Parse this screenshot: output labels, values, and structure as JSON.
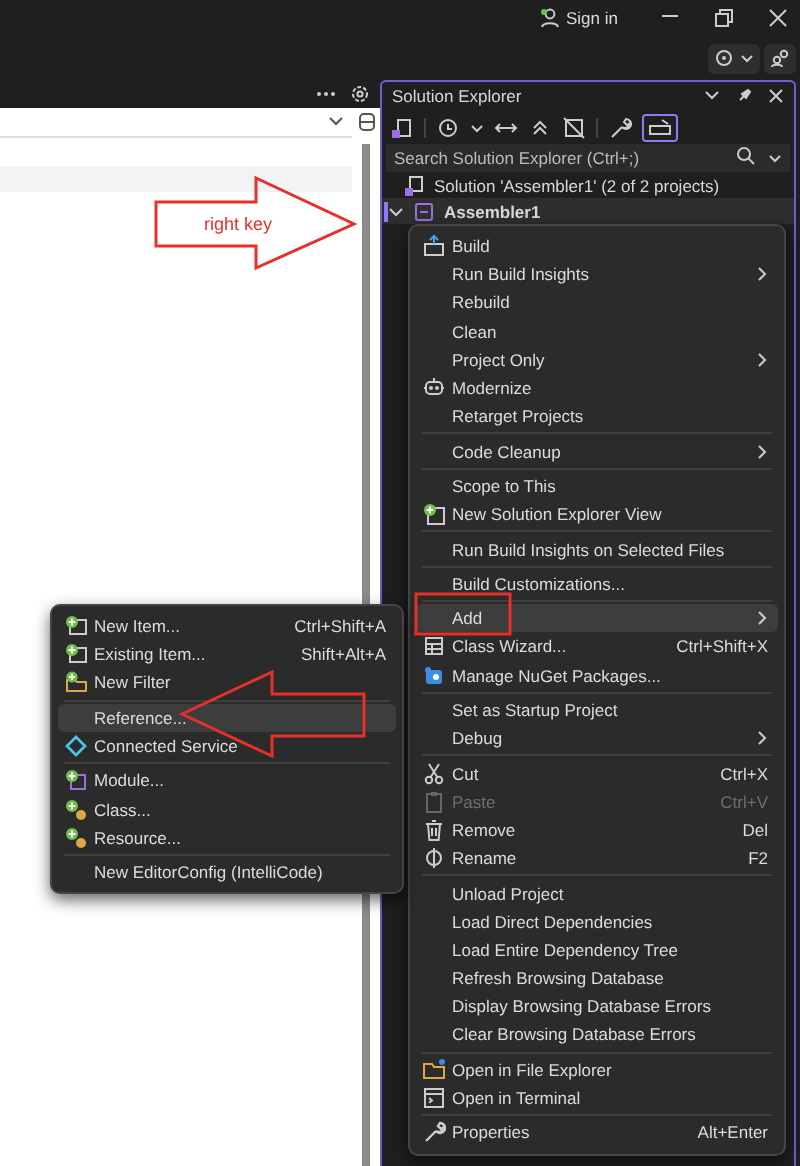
{
  "title_bar": {
    "sign_in": "Sign in"
  },
  "solution_explorer": {
    "title": "Solution Explorer",
    "search": {
      "placeholder": "Search Solution Explorer (Ctrl+;)"
    },
    "tree": [
      {
        "label": "Solution 'Assembler1' (2 of 2 projects)",
        "kind": "solution",
        "selected": false
      },
      {
        "label": "Assembler1",
        "kind": "project",
        "selected": true,
        "expanded": true
      }
    ]
  },
  "context_menu": {
    "items": [
      {
        "kind": "item",
        "label": "Build",
        "selected": false,
        "disabled": false,
        "has_submenu": false
      },
      {
        "kind": "item",
        "label": "Run Build Insights",
        "selected": false,
        "disabled": false,
        "has_submenu": true
      },
      {
        "kind": "item",
        "label": "Rebuild",
        "selected": false,
        "disabled": false,
        "has_submenu": false
      },
      {
        "kind": "item",
        "label": "Clean",
        "selected": false,
        "disabled": false,
        "has_submenu": false
      },
      {
        "kind": "item",
        "label": "Project Only",
        "selected": false,
        "disabled": false,
        "has_submenu": true
      },
      {
        "kind": "item",
        "label": "Modernize",
        "selected": false,
        "disabled": false,
        "has_submenu": false
      },
      {
        "kind": "item",
        "label": "Retarget Projects",
        "selected": false,
        "disabled": false,
        "has_submenu": false
      },
      {
        "kind": "separator"
      },
      {
        "kind": "item",
        "label": "Code Cleanup",
        "selected": false,
        "disabled": false,
        "has_submenu": true
      },
      {
        "kind": "separator"
      },
      {
        "kind": "item",
        "label": "Scope to This",
        "selected": false,
        "disabled": false,
        "has_submenu": false
      },
      {
        "kind": "item",
        "label": "New Solution Explorer View",
        "selected": false,
        "disabled": false,
        "has_submenu": false
      },
      {
        "kind": "separator"
      },
      {
        "kind": "item",
        "label": "Run Build Insights on Selected Files",
        "selected": false,
        "disabled": false,
        "has_submenu": false
      },
      {
        "kind": "separator"
      },
      {
        "kind": "item",
        "label": "Build Customizations...",
        "selected": false,
        "disabled": false,
        "has_submenu": false
      },
      {
        "kind": "separator"
      },
      {
        "kind": "item",
        "label": "Add",
        "selected": true,
        "disabled": false,
        "has_submenu": true
      },
      {
        "kind": "item",
        "label": "Class Wizard...",
        "shortcut": "Ctrl+Shift+X",
        "selected": false,
        "disabled": false,
        "has_submenu": false
      },
      {
        "kind": "item",
        "label": "Manage NuGet Packages...",
        "selected": false,
        "disabled": false,
        "has_submenu": false
      },
      {
        "kind": "separator"
      },
      {
        "kind": "item",
        "label": "Set as Startup Project",
        "selected": false,
        "disabled": false,
        "has_submenu": false
      },
      {
        "kind": "item",
        "label": "Debug",
        "selected": false,
        "disabled": false,
        "has_submenu": true
      },
      {
        "kind": "separator"
      },
      {
        "kind": "item",
        "label": "Cut",
        "shortcut": "Ctrl+X",
        "selected": false,
        "disabled": false,
        "has_submenu": false
      },
      {
        "kind": "item",
        "label": "Paste",
        "shortcut": "Ctrl+V",
        "selected": false,
        "disabled": true,
        "has_submenu": false
      },
      {
        "kind": "item",
        "label": "Remove",
        "shortcut": "Del",
        "selected": false,
        "disabled": false,
        "has_submenu": false
      },
      {
        "kind": "item",
        "label": "Rename",
        "shortcut": "F2",
        "selected": false,
        "disabled": false,
        "has_submenu": false
      },
      {
        "kind": "separator"
      },
      {
        "kind": "item",
        "label": "Unload Project",
        "selected": false,
        "disabled": false,
        "has_submenu": false
      },
      {
        "kind": "item",
        "label": "Load Direct Dependencies",
        "selected": false,
        "disabled": false,
        "has_submenu": false
      },
      {
        "kind": "item",
        "label": "Load Entire Dependency Tree",
        "selected": false,
        "disabled": false,
        "has_submenu": false
      },
      {
        "kind": "item",
        "label": "Refresh Browsing Database",
        "selected": false,
        "disabled": false,
        "has_submenu": false
      },
      {
        "kind": "item",
        "label": "Display Browsing Database Errors",
        "selected": false,
        "disabled": false,
        "has_submenu": false
      },
      {
        "kind": "item",
        "label": "Clear Browsing Database Errors",
        "selected": false,
        "disabled": false,
        "has_submenu": false
      },
      {
        "kind": "separator"
      },
      {
        "kind": "item",
        "label": "Open in File Explorer",
        "selected": false,
        "disabled": false,
        "has_submenu": false
      },
      {
        "kind": "item",
        "label": "Open in Terminal",
        "selected": false,
        "disabled": false,
        "has_submenu": false
      },
      {
        "kind": "separator"
      },
      {
        "kind": "item",
        "label": "Properties",
        "shortcut": "Alt+Enter",
        "selected": false,
        "disabled": false,
        "has_submenu": false
      }
    ]
  },
  "add_submenu": {
    "items": [
      {
        "kind": "item",
        "label": "New Item...",
        "shortcut": "Ctrl+Shift+A",
        "selected": false,
        "disabled": false,
        "has_submenu": false
      },
      {
        "kind": "item",
        "label": "Existing Item...",
        "shortcut": "Shift+Alt+A",
        "selected": false,
        "disabled": false,
        "has_submenu": false
      },
      {
        "kind": "item",
        "label": "New Filter",
        "selected": false,
        "disabled": false,
        "has_submenu": false
      },
      {
        "kind": "separator"
      },
      {
        "kind": "item",
        "label": "Reference...",
        "selected": true,
        "disabled": false,
        "has_submenu": false
      },
      {
        "kind": "item",
        "label": "Connected Service",
        "selected": false,
        "disabled": false,
        "has_submenu": false
      },
      {
        "kind": "separator"
      },
      {
        "kind": "item",
        "label": "Module...",
        "selected": false,
        "disabled": false,
        "has_submenu": false
      },
      {
        "kind": "item",
        "label": "Class...",
        "selected": false,
        "disabled": false,
        "has_submenu": false
      },
      {
        "kind": "item",
        "label": "Resource...",
        "selected": false,
        "disabled": false,
        "has_submenu": false
      },
      {
        "kind": "separator"
      },
      {
        "kind": "item",
        "label": "New EditorConfig (IntelliCode)",
        "selected": false,
        "disabled": false,
        "has_submenu": false
      }
    ]
  },
  "annotations": [
    {
      "kind": "arrow-right",
      "text": "right key"
    },
    {
      "kind": "highlight-box"
    },
    {
      "kind": "arrow-left"
    }
  ]
}
